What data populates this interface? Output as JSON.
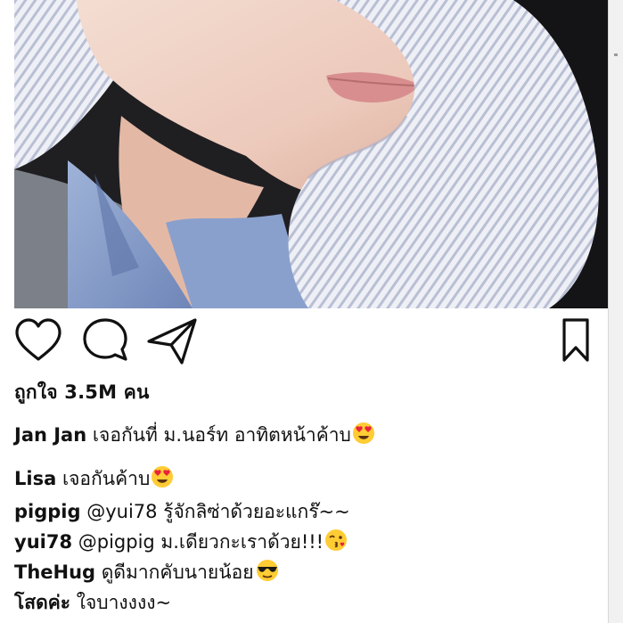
{
  "post": {
    "likes_text": "ถูกใจ 3.5M คน",
    "caption": {
      "username": "Jan Jan",
      "text": "เจอกันที่ ม.นอร์ท อาทิตหน้าค้าบ"
    }
  },
  "comments": [
    {
      "username": "Lisa",
      "text": "เจอกันค้าบ",
      "emoji": "heart-eyes"
    },
    {
      "username": "pigpig",
      "text": "@yui78 รู้จักลิซ่าด้วยอะแกร๊~~",
      "emoji": ""
    },
    {
      "username": "yui78",
      "text": "@pigpig ม.เดียวกะเราด้วย!!!",
      "emoji": "kiss-wink"
    },
    {
      "username": "TheHug",
      "text": "ดูดีมากคับนายน้อย",
      "emoji": "sunglasses"
    },
    {
      "username": "โสดค่ะ",
      "text": "ใจบางงงง~",
      "emoji": ""
    }
  ],
  "icons": {
    "like": "heart-icon",
    "comment": "comment-bubble-icon",
    "share": "paper-plane-icon",
    "save": "bookmark-icon"
  },
  "colors": {
    "text": "#111111",
    "background": "#ffffff",
    "emoji_yellow": "#ffcc33",
    "emoji_heart": "#e8243c"
  }
}
